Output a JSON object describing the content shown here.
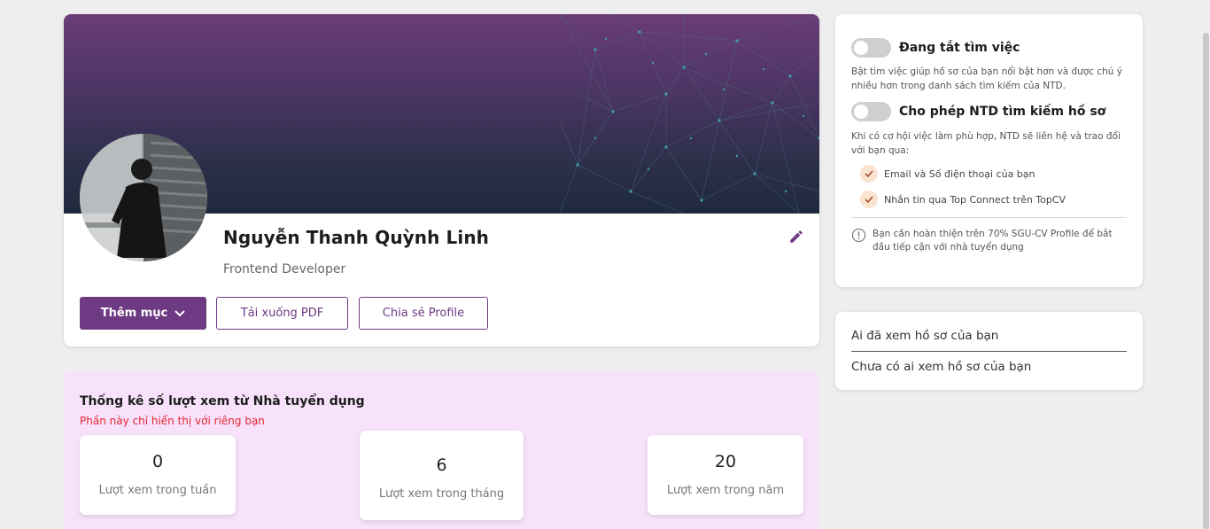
{
  "profile": {
    "name": "Nguyễn Thanh Quỳnh Linh",
    "role": "Frontend Developer",
    "buttons": {
      "add_section": "Thêm mục",
      "download_pdf": "Tải xuống PDF",
      "share_profile": "Chia sẻ Profile"
    }
  },
  "stats": {
    "title": "Thống kê số lượt xem từ Nhà tuyển dụng",
    "note": "Phần này chỉ hiển thị với riêng bạn",
    "week": {
      "value": "0",
      "label": "Lượt xem trong tuần"
    },
    "month": {
      "value": "6",
      "label": "Lượt xem trong tháng"
    },
    "year": {
      "value": "20",
      "label": "Lượt xem trong năm"
    }
  },
  "job_settings": {
    "job_search_toggle": {
      "label": "Đang tắt tìm việc",
      "on": false
    },
    "job_search_desc": "Bật tìm việc giúp hồ sơ của bạn nổi bật hơn và được chú ý nhiều hơn trong danh sách tìm kiếm của NTD.",
    "employer_search_toggle": {
      "label": "Cho phép NTD tìm kiếm hồ sơ",
      "on": false
    },
    "employer_search_desc": "Khi có cơ hội việc làm phù hợp, NTD sẽ liên hệ và trao đổi với bạn qua:",
    "contact_methods": [
      "Email và Số điện thoại của bạn",
      "Nhắn tin qua Top Connect trên TopCV"
    ],
    "warning": "Bạn cần hoàn thiện trên 70% SGU-CV Profile để bắt đầu tiếp cận với nhà tuyển dụng"
  },
  "viewers": {
    "title": "Ai đã xem hồ sơ của bạn",
    "empty": "Chưa có ai xem hồ sơ của bạn"
  },
  "colors": {
    "brand": "#6d3a83",
    "stats_bg": "#f8e2fb",
    "note_red": "#e0262e",
    "check_bg": "#fbe3d2",
    "check_mark": "#a0522d"
  }
}
